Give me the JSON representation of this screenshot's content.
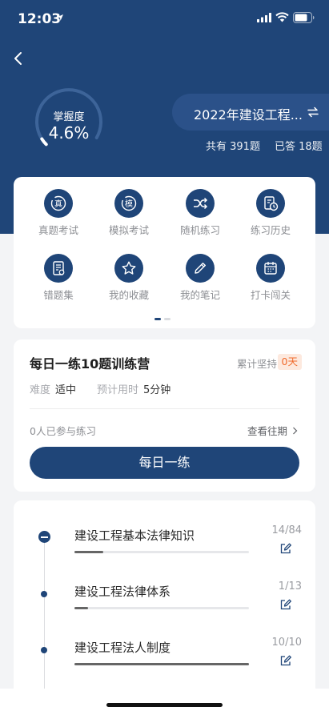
{
  "status_bar": {
    "time": "12:03"
  },
  "header": {
    "mastery": {
      "label": "掌握度",
      "value": "4.6%",
      "percent": 4.6
    },
    "exam_title": "2022年建设工程...",
    "total_text": "共有 391题",
    "answered_text": "已答 18题"
  },
  "functions": [
    {
      "label": "真题考试",
      "icon": "real-exam-icon",
      "glyph": "真"
    },
    {
      "label": "模拟考试",
      "icon": "mock-exam-icon",
      "glyph": "模"
    },
    {
      "label": "随机练习",
      "icon": "shuffle-icon"
    },
    {
      "label": "练习历史",
      "icon": "history-icon"
    },
    {
      "label": "错题集",
      "icon": "wrong-questions-icon"
    },
    {
      "label": "我的收藏",
      "icon": "star-icon"
    },
    {
      "label": "我的笔记",
      "icon": "pencil-icon"
    },
    {
      "label": "打卡闯关",
      "icon": "calendar-icon"
    }
  ],
  "daily": {
    "title": "每日一练10题训练营",
    "persist_label": "累计坚持",
    "persist_value": "0天",
    "difficulty_label": "难度",
    "difficulty_value": "适中",
    "time_label": "预计用时",
    "time_value": "5分钟",
    "participants": "0人已参与练习",
    "history_link": "查看往期",
    "button": "每日一练"
  },
  "chapters": [
    {
      "title": "建设工程基本法律知识",
      "count": "14/84",
      "progress": 0.167
    },
    {
      "title": "建设工程法律体系",
      "count": "1/13",
      "progress": 0.077
    },
    {
      "title": "建设工程法人制度",
      "count": "10/10",
      "progress": 1.0
    }
  ],
  "colors": {
    "primary": "#1f4578",
    "pill": "#2b5189",
    "badge_text": "#f06a2c",
    "badge_bg": "#fde9de",
    "background": "#f3f4f6"
  }
}
